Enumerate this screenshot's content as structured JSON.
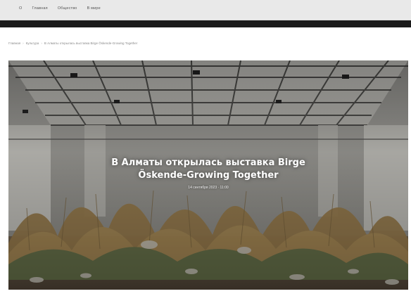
{
  "nav": {
    "items": [
      "О",
      "Главная",
      "Общество",
      "В мире"
    ]
  },
  "breadcrumb": {
    "items": [
      "Главная",
      "Культура",
      "В Алматы открылась выставка Birge Öskende-Growing Together"
    ]
  },
  "article": {
    "title_line1": "В Алматы открылась выставка Birge",
    "title_line2": "Öskende-Growing Together",
    "meta": "14 сентября 2023 · 11:00"
  },
  "colors": {
    "topbar": "#e9e9e9",
    "darkbar": "#1b1b1b",
    "title": "#ffffff"
  }
}
